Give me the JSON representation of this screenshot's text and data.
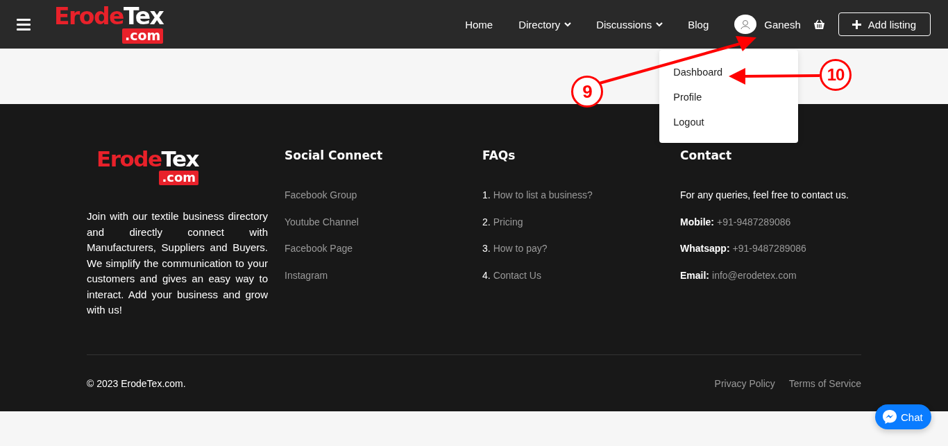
{
  "header": {
    "logo": {
      "part_1": "Erode",
      "part_2": "Tex",
      "suffix": ".com"
    },
    "nav": [
      {
        "label": "Home",
        "dropdown": false
      },
      {
        "label": "Directory",
        "dropdown": true
      },
      {
        "label": "Discussions",
        "dropdown": true
      },
      {
        "label": "Blog",
        "dropdown": false
      }
    ],
    "user": {
      "name": "Ganesh",
      "menu_open": true,
      "menu": [
        "Dashboard",
        "Profile",
        "Logout"
      ]
    },
    "add_button": "Add listing"
  },
  "footer": {
    "logo": {
      "part_1": "Erode",
      "part_2": "Tex",
      "suffix": ".com"
    },
    "about": "Join with our textile business directory and directly connect with Manufacturers, Suppliers and Buyers. We simplify the communication to your customers and gives an easy way to interact. Add your business and grow with us!",
    "social": {
      "title": "Social Connect",
      "links": [
        "Facebook Group",
        "Youtube Channel",
        "Facebook Page",
        "Instagram"
      ]
    },
    "faqs": {
      "title": "FAQs",
      "items": [
        {
          "number": "1.",
          "link": "How to list a business?"
        },
        {
          "number": "2.",
          "link": "Pricing"
        },
        {
          "number": "3.",
          "link": "How to pay?"
        },
        {
          "number": "4.",
          "link": "Contact Us"
        }
      ]
    },
    "contact": {
      "title": "Contact",
      "intro": "For any queries, feel free to contact us.",
      "rows": [
        {
          "label": "Mobile:",
          "value": "+91-9487289086"
        },
        {
          "label": "Whatsapp:",
          "value": "+91-9487289086"
        },
        {
          "label": "Email:",
          "value": "info@erodetex.com"
        }
      ]
    },
    "copyright": "© 2023 ErodeTex.com.",
    "legal_links": [
      "Privacy Policy",
      "Terms of Service"
    ]
  },
  "chat_button": "Chat",
  "annotations": [
    {
      "label": "9"
    },
    {
      "label": "10"
    }
  ]
}
